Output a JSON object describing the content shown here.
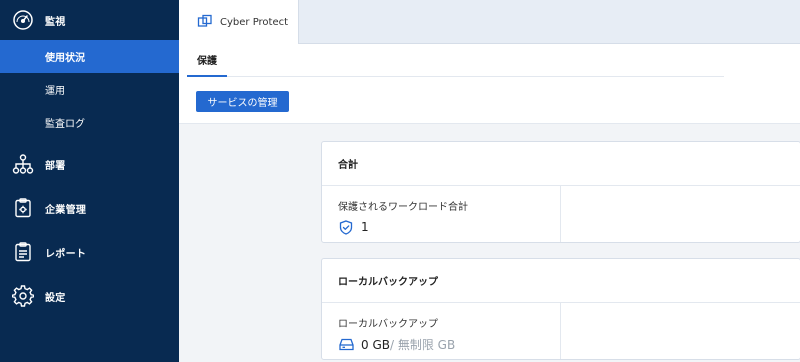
{
  "sidebar": {
    "monitor": {
      "label": "監視",
      "icon": "gauge-icon"
    },
    "monitor_items": [
      {
        "label": "使用状況",
        "active": true
      },
      {
        "label": "運用",
        "active": false
      },
      {
        "label": "監査ログ",
        "active": false
      }
    ],
    "department": {
      "label": "部署",
      "icon": "org-tree-icon"
    },
    "company": {
      "label": "企業管理",
      "icon": "clipboard-gear-icon"
    },
    "reports": {
      "label": "レポート",
      "icon": "report-icon"
    },
    "settings": {
      "label": "設定",
      "icon": "gear-icon"
    }
  },
  "tabbar": {
    "product": {
      "label": "Cyber Protect",
      "icon": "cyber-protect-icon"
    }
  },
  "toolbar": {
    "subtab": "保護",
    "manage_button": "サービスの管理"
  },
  "cards": {
    "total": {
      "title": "合計",
      "label": "保護されるワークロード合計",
      "value": "1",
      "icon": "shield-check-icon"
    },
    "local_backup": {
      "title": "ローカルバックアップ",
      "label": "ローカルバックアップ",
      "value": "0 GB",
      "quota": " / 無制限 GB",
      "icon": "disk-icon"
    }
  },
  "colors": {
    "sidebar_bg": "#082a51",
    "accent": "#2469d0"
  }
}
